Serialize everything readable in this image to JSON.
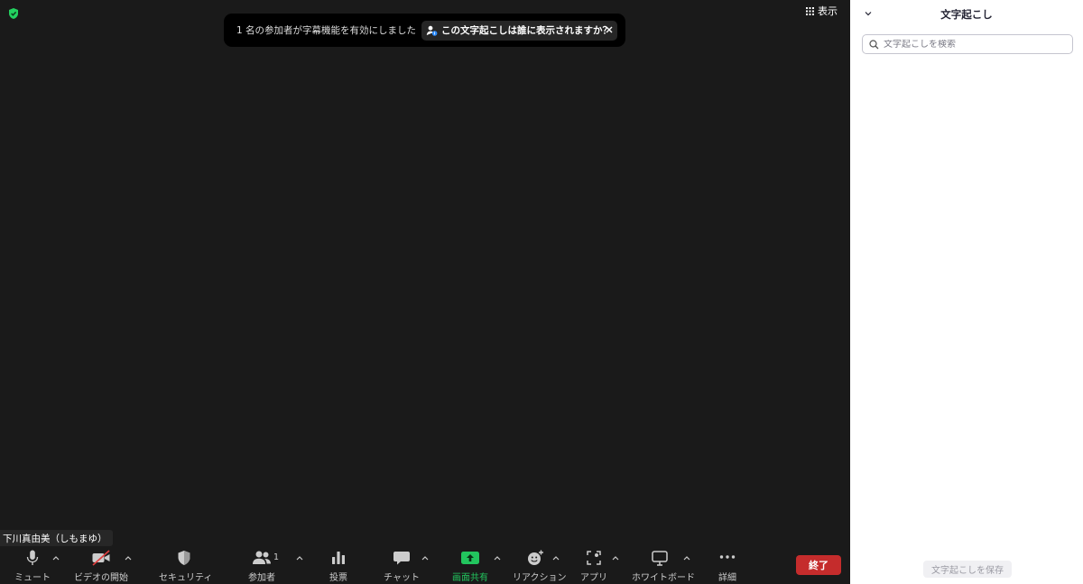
{
  "meeting": {
    "view_button_label": "表示",
    "participant_name": "下川真由美（しもまゆ）"
  },
  "caption_banner": {
    "message": "1 名の参加者が字幕機能を有効にしました",
    "who_can_see_label": "この文字起こしは誰に表示されますか？"
  },
  "toolbar": {
    "mute_label": "ミュート",
    "start_video_label": "ビデオの開始",
    "security_label": "セキュリティ",
    "participants_label": "参加者",
    "participants_count": "1",
    "polls_label": "投票",
    "chat_label": "チャット",
    "share_screen_label": "画面共有",
    "reactions_label": "リアクション",
    "apps_label": "アプリ",
    "whiteboard_label": "ホワイトボード",
    "more_label": "詳細",
    "end_label": "終了"
  },
  "transcript_panel": {
    "title": "文字起こし",
    "search_placeholder": "文字起こしを検索",
    "search_value": "",
    "save_label": "文字起こしを保存"
  },
  "colors": {
    "meeting_background": "#1a1a1a",
    "share_green": "#22c55e",
    "end_red": "#c52c2c",
    "security_badge_green": "#23d160"
  }
}
